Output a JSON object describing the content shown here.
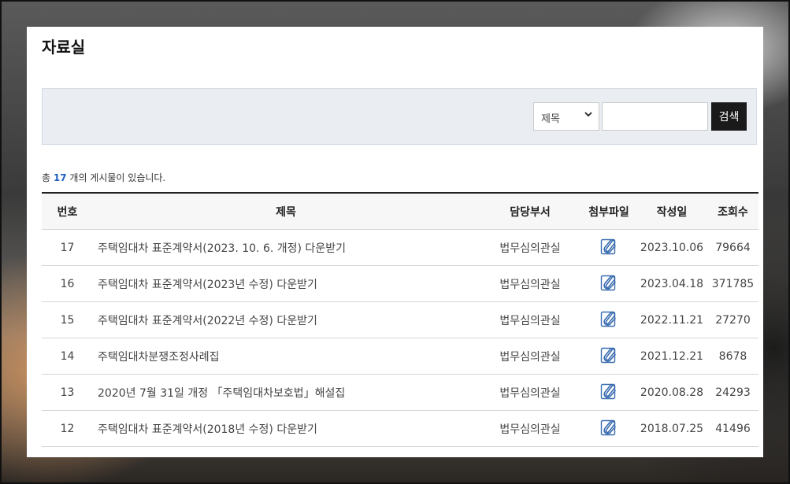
{
  "page": {
    "title": "자료실"
  },
  "search": {
    "field_selected": "제목",
    "input_value": "",
    "button_label": "검색"
  },
  "summary": {
    "prefix": "총",
    "count": "17",
    "suffix": "개의 게시물이 있습니다."
  },
  "table": {
    "headers": [
      "번호",
      "제목",
      "담당부서",
      "첨부파일",
      "작성일",
      "조회수"
    ],
    "rows": [
      {
        "no": "17",
        "title": "주택임대차 표준계약서(2023. 10. 6. 개정) 다운받기",
        "dept": "법무심의관실",
        "attachment_icon": "paperclip-icon",
        "date": "2023.10.06",
        "views": "79664"
      },
      {
        "no": "16",
        "title": "주택임대차 표준계약서(2023년 수정) 다운받기",
        "dept": "법무심의관실",
        "attachment_icon": "paperclip-icon",
        "date": "2023.04.18",
        "views": "371785"
      },
      {
        "no": "15",
        "title": "주택임대차 표준계약서(2022년 수정) 다운받기",
        "dept": "법무심의관실",
        "attachment_icon": "paperclip-icon",
        "date": "2022.11.21",
        "views": "27270"
      },
      {
        "no": "14",
        "title": "주택임대차분쟁조정사례집",
        "dept": "법무심의관실",
        "attachment_icon": "paperclip-icon",
        "date": "2021.12.21",
        "views": "8678"
      },
      {
        "no": "13",
        "title": "2020년 7월 31일 개정 「주택임대차보호법」해설집",
        "dept": "법무심의관실",
        "attachment_icon": "paperclip-icon",
        "date": "2020.08.28",
        "views": "24293"
      },
      {
        "no": "12",
        "title": "주택임대차 표준계약서(2018년 수정) 다운받기",
        "dept": "법무심의관실",
        "attachment_icon": "paperclip-icon",
        "date": "2018.07.25",
        "views": "41496"
      }
    ]
  },
  "colors": {
    "accent_count": "#1f5fbf",
    "button_bg": "#1a1a1a",
    "search_bg": "#eaeef3",
    "icon_blue": "#3b6db0"
  }
}
